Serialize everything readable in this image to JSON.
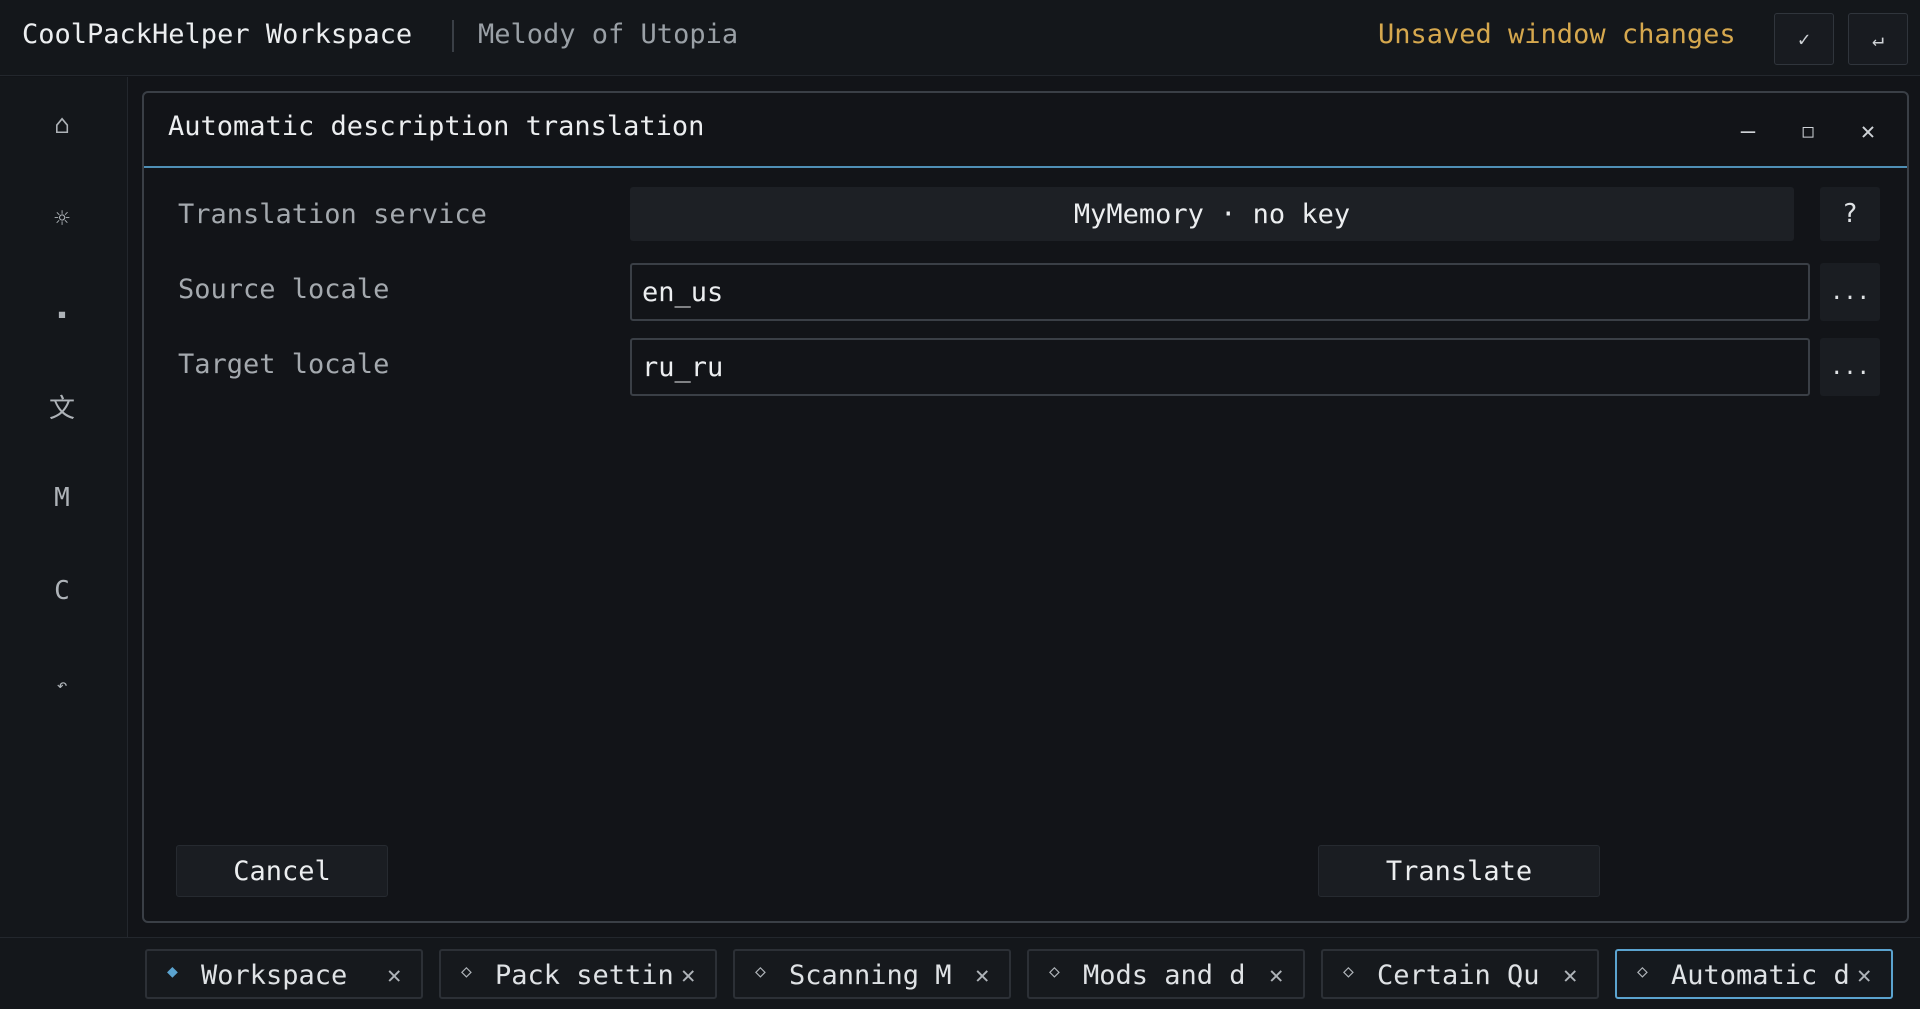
{
  "topbar": {
    "app_title": "CoolPackHelper Workspace",
    "project_name": "Melody of Utopia",
    "unsaved_text": "Unsaved window changes",
    "unsaved_color": "#d6a84e",
    "apply_icon": "✓",
    "revert_icon": "↵"
  },
  "sidebar": {
    "items": [
      {
        "icon": "⌂",
        "name": "home-icon"
      },
      {
        "icon": "☼",
        "name": "settings-icon"
      },
      {
        "icon": "▪",
        "name": "block-icon"
      },
      {
        "icon": "文",
        "name": "translate-icon"
      },
      {
        "icon": "M",
        "name": "mods-icon"
      },
      {
        "icon": "C",
        "name": "config-icon"
      },
      {
        "icon": "↶",
        "name": "undo-icon"
      }
    ]
  },
  "dialog": {
    "title": "Automatic description translation",
    "controls": {
      "minimize": "—",
      "maximize": "□",
      "close": "✕"
    },
    "service_label": "Translation service",
    "service_value": "MyMemory · no key",
    "help_label": "?",
    "source_label": "Source locale",
    "source_value": "en_us",
    "target_label": "Target locale",
    "target_value": "ru_ru",
    "browse_label": "...",
    "cancel_label": "Cancel",
    "translate_label": "Translate",
    "accent_color": "#4f8fb5"
  },
  "tabs": [
    {
      "icon": "◆",
      "label": "Workspace",
      "close": "✕"
    },
    {
      "icon": "◇",
      "label": "Pack settin",
      "close": "✕"
    },
    {
      "icon": "◇",
      "label": "Scanning M",
      "close": "✕"
    },
    {
      "icon": "◇",
      "label": "Mods and d",
      "close": "✕"
    },
    {
      "icon": "◇",
      "label": "Certain Qu",
      "close": "✕"
    },
    {
      "icon": "◇",
      "label": "Automatic d",
      "close": "✕"
    }
  ]
}
